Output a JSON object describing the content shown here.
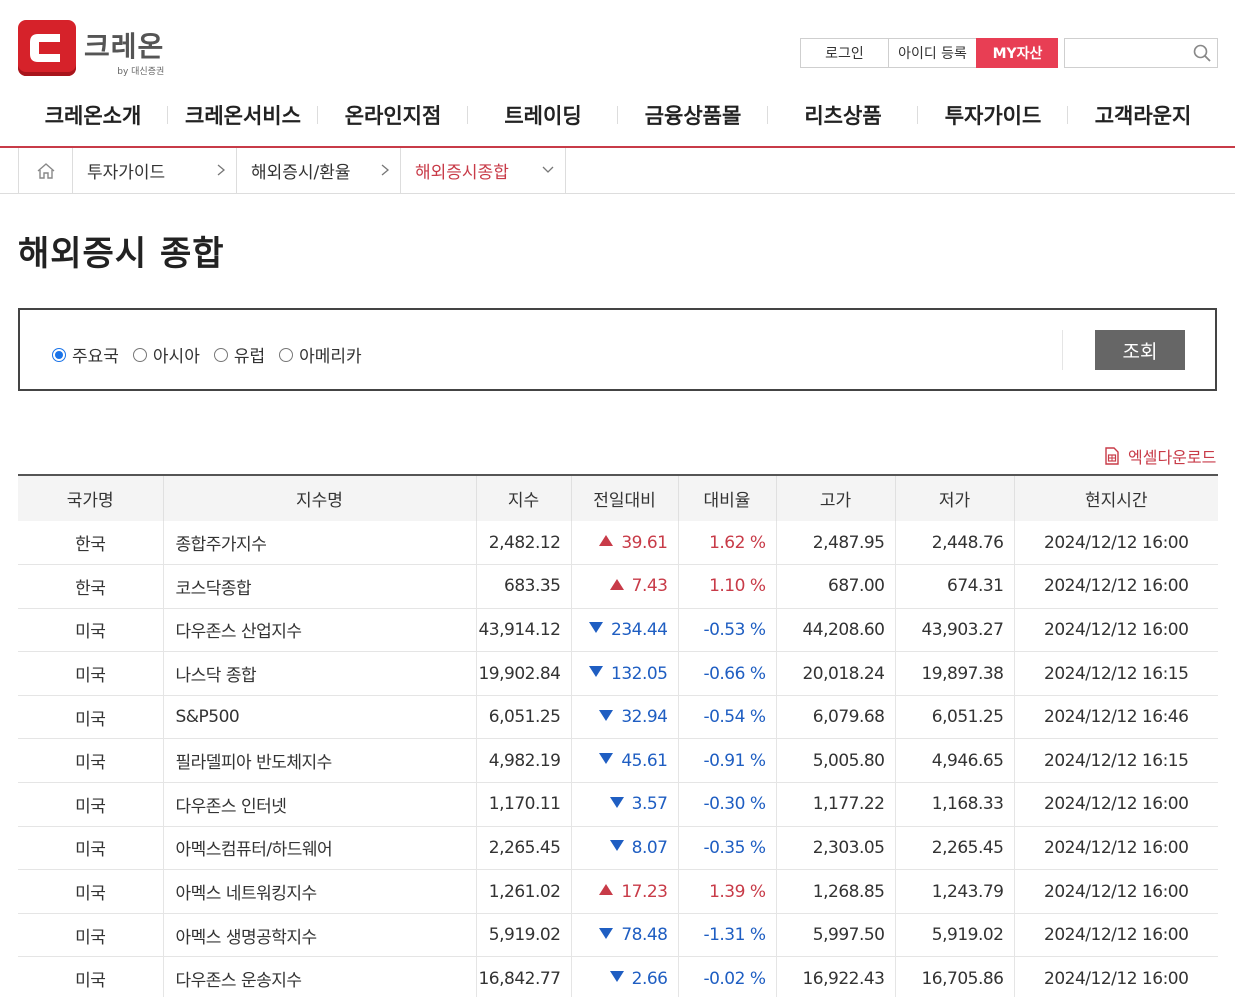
{
  "header": {
    "logo_title": "크레온",
    "logo_sub": "by 대신증권",
    "util": {
      "login": "로그인",
      "join": "아이디 등록",
      "my": "MY자산"
    },
    "search_placeholder": ""
  },
  "gnb": [
    "크레온소개",
    "크레온서비스",
    "온라인지점",
    "트레이딩",
    "금융상품몰",
    "리츠상품",
    "투자가이드",
    "고객라운지"
  ],
  "breadcrumb": [
    "투자가이드",
    "해외증시/환율",
    "해외증시종합"
  ],
  "page_title": "해외증시 종합",
  "filter": {
    "options": [
      "주요국",
      "아시아",
      "유럽",
      "아메리카"
    ],
    "selected": "주요국",
    "button": "조회"
  },
  "excel_label": "엑셀다운로드",
  "table": {
    "headers": [
      "국가명",
      "지수명",
      "지수",
      "전일대비",
      "대비율",
      "고가",
      "저가",
      "현지시간"
    ],
    "rows": [
      {
        "country": "한국",
        "name": "종합주가지수",
        "index": "2,482.12",
        "dir": "up",
        "change": "39.61",
        "rate": "1.62 %",
        "high": "2,487.95",
        "low": "2,448.76",
        "time": "2024/12/12 16:00"
      },
      {
        "country": "한국",
        "name": "코스닥종합",
        "index": "683.35",
        "dir": "up",
        "change": "7.43",
        "rate": "1.10 %",
        "high": "687.00",
        "low": "674.31",
        "time": "2024/12/12 16:00"
      },
      {
        "country": "미국",
        "name": "다우존스 산업지수",
        "index": "43,914.12",
        "dir": "down",
        "change": "234.44",
        "rate": "-0.53 %",
        "high": "44,208.60",
        "low": "43,903.27",
        "time": "2024/12/12 16:00"
      },
      {
        "country": "미국",
        "name": "나스닥 종합",
        "index": "19,902.84",
        "dir": "down",
        "change": "132.05",
        "rate": "-0.66 %",
        "high": "20,018.24",
        "low": "19,897.38",
        "time": "2024/12/12 16:15"
      },
      {
        "country": "미국",
        "name": "S&P500",
        "index": "6,051.25",
        "dir": "down",
        "change": "32.94",
        "rate": "-0.54 %",
        "high": "6,079.68",
        "low": "6,051.25",
        "time": "2024/12/12 16:46"
      },
      {
        "country": "미국",
        "name": "필라델피아 반도체지수",
        "index": "4,982.19",
        "dir": "down",
        "change": "45.61",
        "rate": "-0.91 %",
        "high": "5,005.80",
        "low": "4,946.65",
        "time": "2024/12/12 16:15"
      },
      {
        "country": "미국",
        "name": "다우존스 인터넷",
        "index": "1,170.11",
        "dir": "down",
        "change": "3.57",
        "rate": "-0.30 %",
        "high": "1,177.22",
        "low": "1,168.33",
        "time": "2024/12/12 16:00"
      },
      {
        "country": "미국",
        "name": "아멕스컴퓨터/하드웨어",
        "index": "2,265.45",
        "dir": "down",
        "change": "8.07",
        "rate": "-0.35 %",
        "high": "2,303.05",
        "low": "2,265.45",
        "time": "2024/12/12 16:00"
      },
      {
        "country": "미국",
        "name": "아멕스 네트워킹지수",
        "index": "1,261.02",
        "dir": "up",
        "change": "17.23",
        "rate": "1.39 %",
        "high": "1,268.85",
        "low": "1,243.79",
        "time": "2024/12/12 16:00"
      },
      {
        "country": "미국",
        "name": "아멕스 생명공학지수",
        "index": "5,919.02",
        "dir": "down",
        "change": "78.48",
        "rate": "-1.31 %",
        "high": "5,997.50",
        "low": "5,919.02",
        "time": "2024/12/12 16:00"
      },
      {
        "country": "미국",
        "name": "다우존스 운송지수",
        "index": "16,842.77",
        "dir": "down",
        "change": "2.66",
        "rate": "-0.02 %",
        "high": "16,922.43",
        "low": "16,705.86",
        "time": "2024/12/12 16:00"
      }
    ]
  },
  "colors": {
    "brand_red": "#d6222a",
    "accent": "#c83b48",
    "up": "#c83b48",
    "down": "#1f5ec2",
    "my_btn": "#e83e54"
  }
}
